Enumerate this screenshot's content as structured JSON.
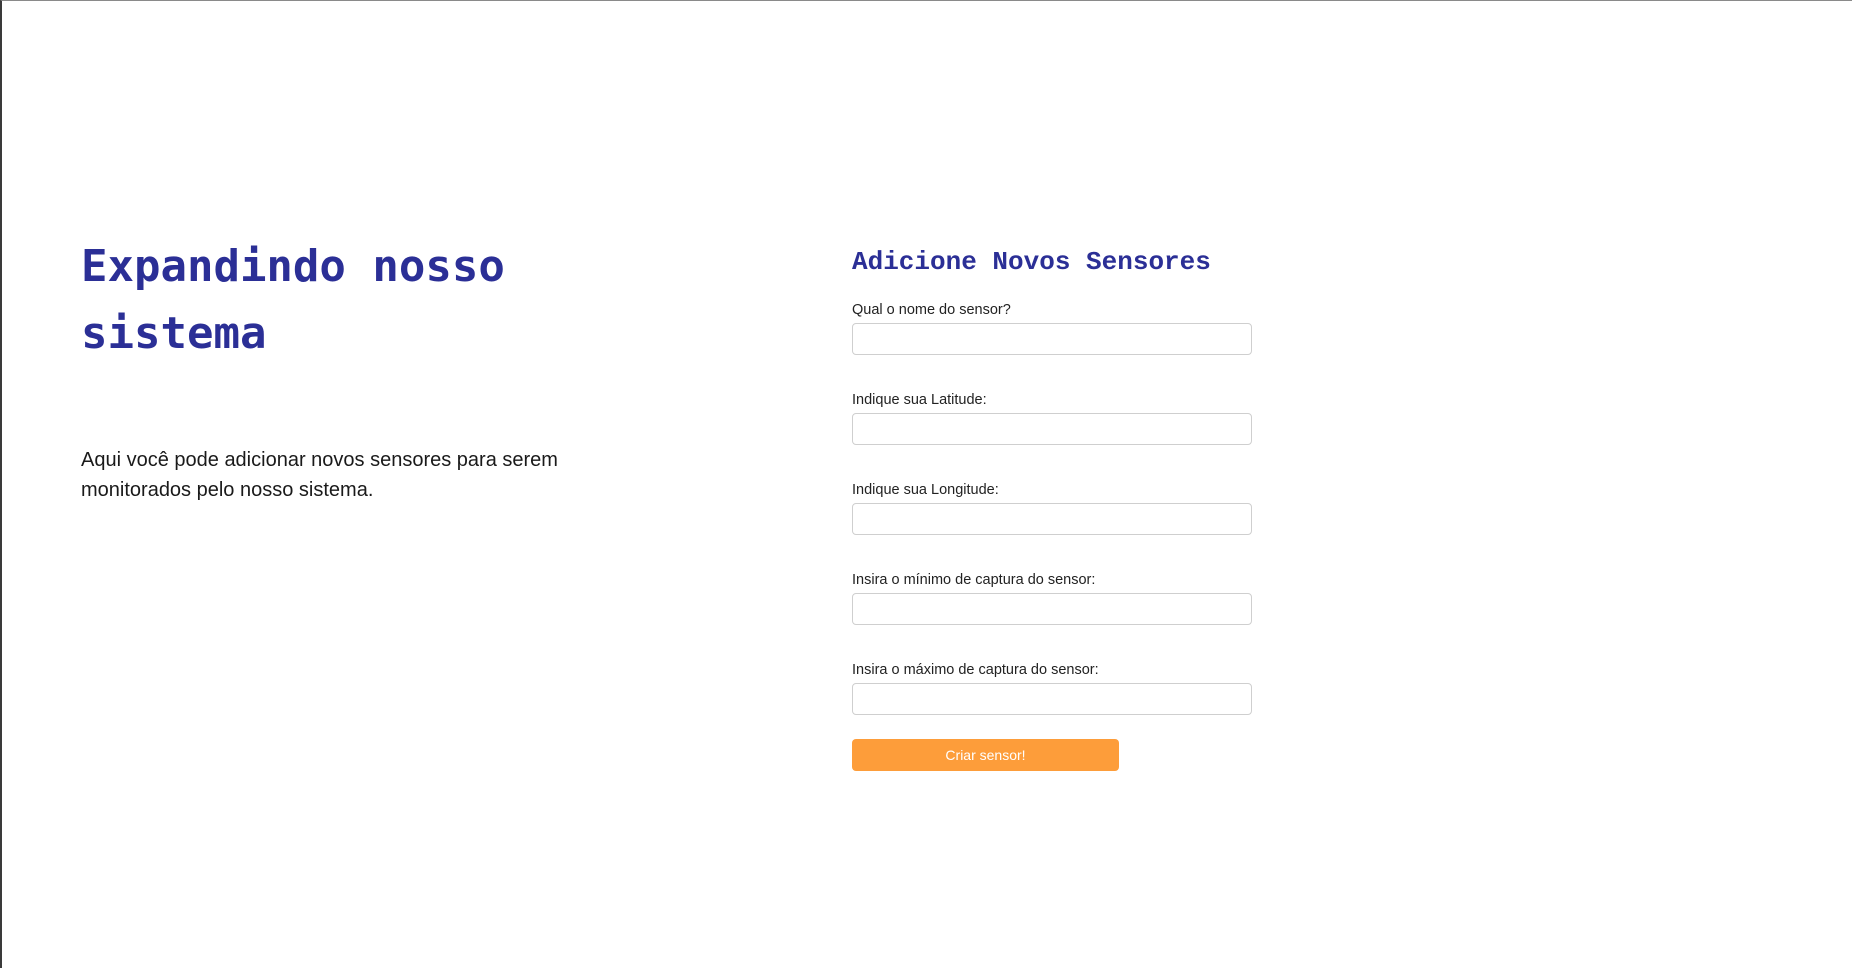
{
  "hero": {
    "title": "Expandindo nosso sistema",
    "description": "Aqui você pode adicionar novos sensores para serem monitorados pelo nosso sistema."
  },
  "form": {
    "title": "Adicione Novos Sensores",
    "fields": [
      {
        "label": "Qual o nome do sensor?",
        "value": ""
      },
      {
        "label": "Indique sua Latitude:",
        "value": ""
      },
      {
        "label": "Indique sua Longitude:",
        "value": ""
      },
      {
        "label": "Insira o mínimo de captura do sensor:",
        "value": ""
      },
      {
        "label": "Insira o máximo de captura do sensor:",
        "value": ""
      }
    ],
    "submit_label": "Criar sensor!"
  },
  "colors": {
    "heading": "#2b2f96",
    "button": "#fd9d3a",
    "button_text": "#ffffff",
    "input_border": "#cfcfcf"
  }
}
